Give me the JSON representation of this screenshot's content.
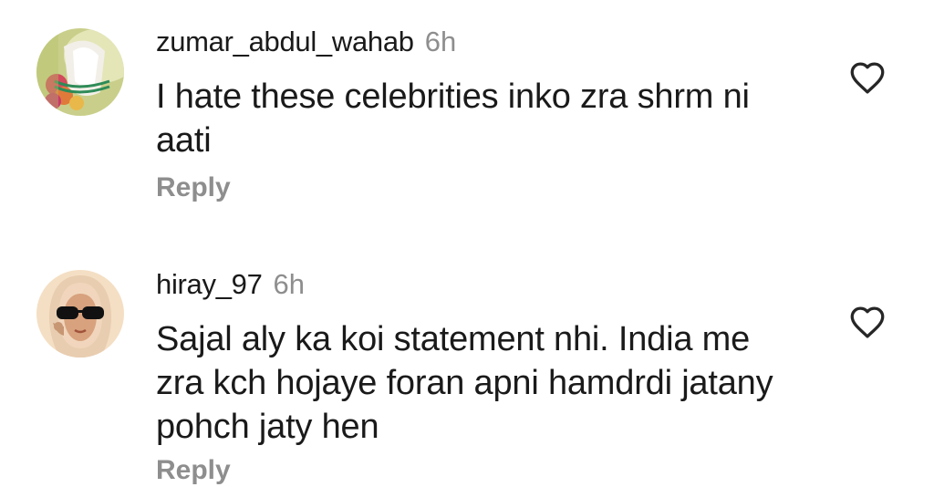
{
  "comments": [
    {
      "username": "zumar_abdul_wahab",
      "time": "6h",
      "text": "I hate these celebrities inko zra shrm ni aati",
      "reply_label": "Reply",
      "avatar_icon": "user-avatar-photo",
      "like_icon": "heart-outline-icon"
    },
    {
      "username": "hiray_97",
      "time": "6h",
      "text": "Sajal aly ka koi statement nhi. India me zra kch hojaye foran apni hamdrdi jatany pohch jaty hen",
      "reply_label": "Reply",
      "avatar_icon": "user-avatar-illustration",
      "like_icon": "heart-outline-icon"
    }
  ],
  "colors": {
    "text": "#1a1a1a",
    "secondary": "#8e8e8e",
    "background": "#ffffff"
  }
}
